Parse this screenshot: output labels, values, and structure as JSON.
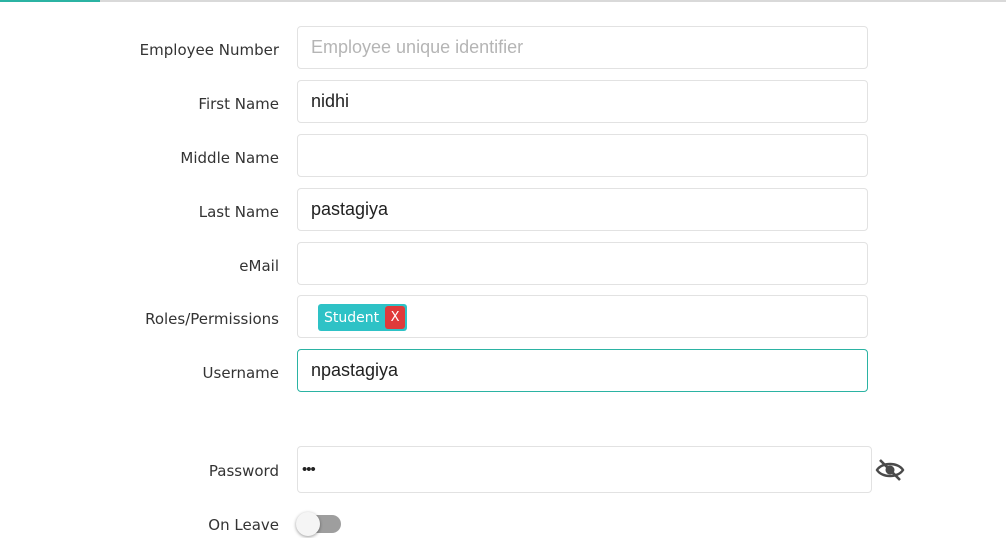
{
  "form": {
    "employee_number": {
      "label": "Employee Number",
      "value": "",
      "placeholder": "Employee unique identifier"
    },
    "first_name": {
      "label": "First Name",
      "value": "nidhi"
    },
    "middle_name": {
      "label": "Middle Name",
      "value": ""
    },
    "last_name": {
      "label": "Last Name",
      "value": "pastagiya"
    },
    "email": {
      "label": "eMail",
      "value": ""
    },
    "roles": {
      "label": "Roles/Permissions",
      "tags": [
        {
          "label": "Student",
          "remove": "X"
        }
      ]
    },
    "username": {
      "label": "Username",
      "value": "npastagiya"
    },
    "password": {
      "label": "Password",
      "value": "•••"
    },
    "on_leave": {
      "label": "On Leave",
      "checked": false
    }
  },
  "colors": {
    "accent": "#2bb3a3",
    "tag": "#2ec2c6",
    "tag_remove": "#e03a3a"
  },
  "icons": {
    "password_visibility": "eye-slash-icon"
  }
}
